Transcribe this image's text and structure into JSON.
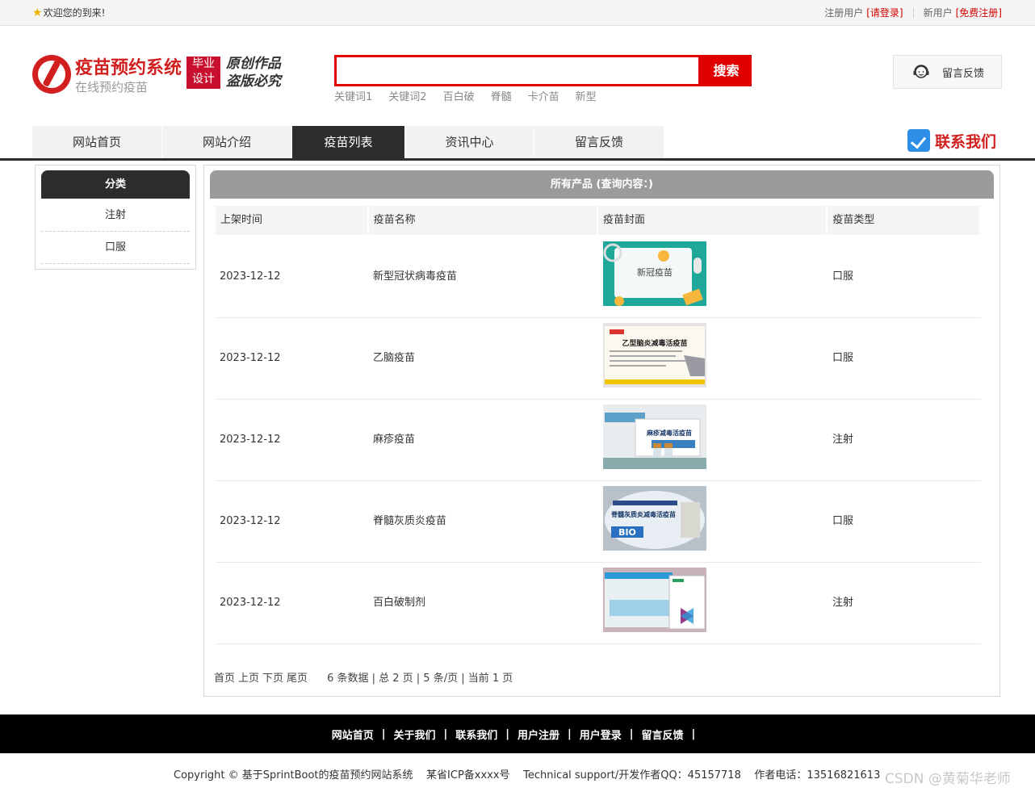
{
  "topbar": {
    "welcome": "欢迎您的到来!",
    "registered_label": "注册用户",
    "login_link": "[请登录]",
    "new_user_label": "新用户",
    "register_link": "[免费注册]"
  },
  "header": {
    "site_name": "疫苗预约系统",
    "site_subtitle": "在线预约疫苗",
    "badge_line1": "毕业",
    "badge_line2": "设计",
    "slogan_line1": "原创作品",
    "slogan_line2": "盗版必究",
    "search_placeholder": "",
    "search_button": "搜索",
    "keywords": [
      "关键词1",
      "关键词2",
      "百白破",
      "脊髓",
      "卡介苗",
      "新型"
    ],
    "feedback_button": "留言反馈"
  },
  "nav": {
    "items": [
      "网站首页",
      "网站介绍",
      "疫苗列表",
      "资讯中心",
      "留言反馈"
    ],
    "active": "疫苗列表",
    "contact": "联系我们"
  },
  "sidebar": {
    "title": "分类",
    "categories": [
      "注射",
      "口服"
    ]
  },
  "main": {
    "title": "所有产品 (查询内容：)",
    "columns": [
      "上架时间",
      "疫苗名称",
      "疫苗封面",
      "疫苗类型"
    ],
    "rows": [
      {
        "date": "2023-12-12",
        "name": "新型冠状病毒疫苗",
        "cover_text": "新冠疫苗",
        "type": "口服"
      },
      {
        "date": "2023-12-12",
        "name": "乙脑疫苗",
        "cover_text": "乙型脑炎减毒活疫苗",
        "type": "口服"
      },
      {
        "date": "2023-12-12",
        "name": "麻疹疫苗",
        "cover_text": "麻疹减毒活疫苗",
        "type": "注射"
      },
      {
        "date": "2023-12-12",
        "name": "脊髓灰质炎疫苗",
        "cover_text": "脊髓灰质炎减毒活疫苗",
        "type": "口服"
      },
      {
        "date": "2023-12-12",
        "name": "百白破制剂",
        "cover_text": "",
        "type": "注射"
      }
    ],
    "pager": {
      "first": "首页",
      "prev": "上页",
      "next": "下页",
      "last": "尾页",
      "info": "6 条数据 | 总 2 页 | 5 条/页 | 当前 1 页"
    }
  },
  "footer": {
    "links": [
      "网站首页",
      "关于我们",
      "联系我们",
      "用户注册",
      "用户登录",
      "留言反馈"
    ],
    "copyright": "Copyright © 基于SprintBoot的疫苗预约网站系统    某省ICP备xxxx号    Technical support/开发作者QQ：45157718    作者电话：13516821613"
  },
  "watermark": "CSDN @黄菊华老师",
  "colors": {
    "brand_red": "#d11f1f",
    "search_red": "#e00000",
    "nav_dark": "#2d2d2d",
    "panel_gray": "#9b9b9b"
  }
}
